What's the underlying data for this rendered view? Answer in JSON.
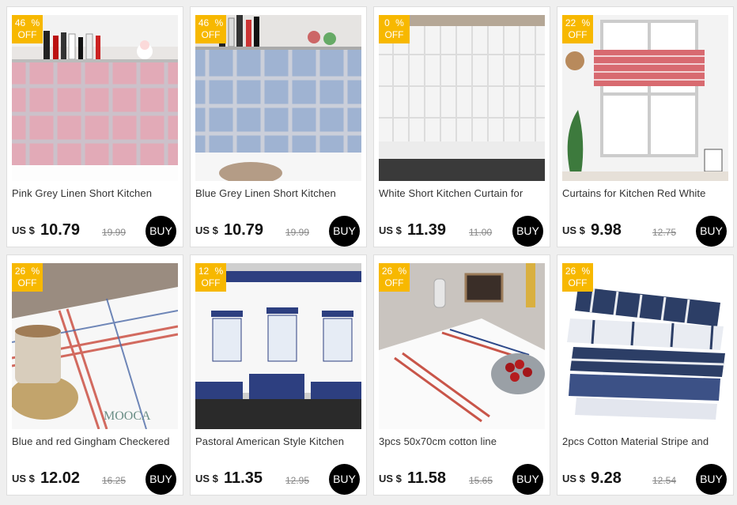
{
  "colors": {
    "badge": "#f7b800",
    "buy_button": "#000000",
    "page_bg": "#efefef"
  },
  "products": [
    {
      "title": "Pink Grey Linen Short Kitchen",
      "discount_value": "46",
      "discount_symbol": "%",
      "discount_label": "OFF",
      "currency": "US $",
      "price": "10.79",
      "old_price": "19.99",
      "buy_label": "BUY",
      "image": "pink-plaid-curtain-shelf"
    },
    {
      "title": "Blue Grey Linen Short Kitchen",
      "discount_value": "46",
      "discount_symbol": "%",
      "discount_label": "OFF",
      "currency": "US $",
      "price": "10.79",
      "old_price": "19.99",
      "buy_label": "BUY",
      "image": "blue-plaid-curtain-shelf"
    },
    {
      "title": "White Short Kitchen Curtain for",
      "discount_value": "0",
      "discount_symbol": "%",
      "discount_label": "OFF",
      "currency": "US $",
      "price": "11.39",
      "old_price": "11.00",
      "buy_label": "BUY",
      "image": "white-lace-curtain"
    },
    {
      "title": "Curtains for Kitchen Red White",
      "discount_value": "22",
      "discount_symbol": "%",
      "discount_label": "OFF",
      "currency": "US $",
      "price": "9.98",
      "old_price": "12.75",
      "buy_label": "BUY",
      "image": "red-gingham-window-valance"
    },
    {
      "title": "Blue and red Gingham Checkered",
      "discount_value": "26",
      "discount_symbol": "%",
      "discount_label": "OFF",
      "currency": "US $",
      "price": "12.02",
      "old_price": "16.25",
      "buy_label": "BUY",
      "image": "gingham-towel-with-cup",
      "watermark": "MOOCA"
    },
    {
      "title": "Pastoral American Style Kitchen",
      "discount_value": "12",
      "discount_symbol": "%",
      "discount_label": "OFF",
      "currency": "US $",
      "price": "11.35",
      "old_price": "12.95",
      "buy_label": "BUY",
      "image": "pastoral-embroidered-valance"
    },
    {
      "title": "3pcs 50x70cm cotton line",
      "discount_value": "26",
      "discount_symbol": "%",
      "discount_label": "OFF",
      "currency": "US $",
      "price": "11.58",
      "old_price": "15.65",
      "buy_label": "BUY",
      "image": "striped-towels-with-cherries"
    },
    {
      "title": "2pcs Cotton Material Stripe and",
      "discount_value": "26",
      "discount_symbol": "%",
      "discount_label": "OFF",
      "currency": "US $",
      "price": "9.28",
      "old_price": "12.54",
      "buy_label": "BUY",
      "image": "navy-striped-towel-stack"
    }
  ]
}
